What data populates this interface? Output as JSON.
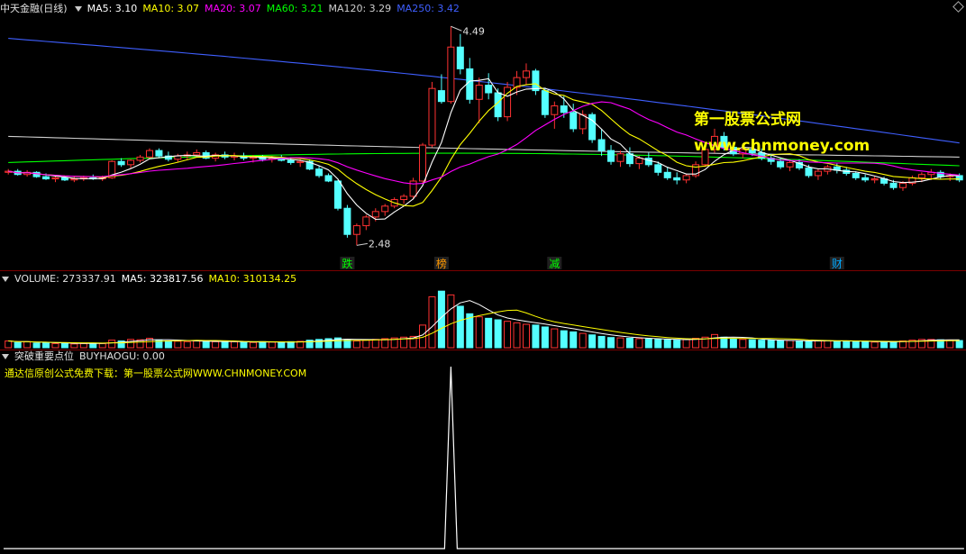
{
  "header": {
    "stock_name": "中天金融",
    "period": "(日线)",
    "ma": [
      {
        "label": "MA5: 3.10",
        "color": "#ffffff"
      },
      {
        "label": "MA10: 3.07",
        "color": "#ffff00"
      },
      {
        "label": "MA20: 3.07",
        "color": "#ff00ff"
      },
      {
        "label": "MA60: 3.21",
        "color": "#00ff00"
      },
      {
        "label": "MA120: 3.29",
        "color": "#cfcfcf"
      },
      {
        "label": "MA250: 3.42",
        "color": "#3f5fff"
      }
    ]
  },
  "volume_header": {
    "title": "VOLUME: 273337.91",
    "ma5": "MA5: 323817.56",
    "ma10": "MA10: 310134.25"
  },
  "indicator_header": {
    "name": "突破重要点位",
    "value": "BUYHAOGU: 0.00"
  },
  "download_text": "通达信原创公式免费下载：第一股票公式网WWW.CHNMONEY.COM",
  "watermark": {
    "line1": "第一股票公式网",
    "line2": "www.chnmoney.com"
  },
  "markers": [
    {
      "text": "跌",
      "bar": 36,
      "color": "#00ff00"
    },
    {
      "text": "榜",
      "bar": 46,
      "color": "#ff9900"
    },
    {
      "text": "减",
      "bar": 58,
      "color": "#00ff00"
    },
    {
      "text": "财",
      "bar": 88,
      "color": "#00aaff"
    }
  ],
  "chart_data": {
    "type": "candlestick",
    "ylim": [
      2.4,
      4.55
    ],
    "high_label": "4.49",
    "low_label": "2.48",
    "high_bar": 47,
    "low_bar": 37,
    "colors": {
      "up": "#ff3232",
      "down": "#54ffff"
    },
    "candles": [
      [
        3.15,
        3.18,
        3.13,
        3.16
      ],
      [
        3.16,
        3.18,
        3.12,
        3.13
      ],
      [
        3.13,
        3.17,
        3.11,
        3.15
      ],
      [
        3.15,
        3.16,
        3.1,
        3.11
      ],
      [
        3.11,
        3.14,
        3.08,
        3.09
      ],
      [
        3.09,
        3.12,
        3.06,
        3.1
      ],
      [
        3.1,
        3.12,
        3.07,
        3.08
      ],
      [
        3.08,
        3.11,
        3.06,
        3.09
      ],
      [
        3.09,
        3.12,
        3.07,
        3.1
      ],
      [
        3.1,
        3.13,
        3.08,
        3.09
      ],
      [
        3.09,
        3.12,
        3.07,
        3.1
      ],
      [
        3.1,
        3.26,
        3.09,
        3.25
      ],
      [
        3.25,
        3.28,
        3.2,
        3.22
      ],
      [
        3.22,
        3.27,
        3.19,
        3.26
      ],
      [
        3.26,
        3.31,
        3.24,
        3.29
      ],
      [
        3.29,
        3.37,
        3.27,
        3.35
      ],
      [
        3.35,
        3.37,
        3.28,
        3.3
      ],
      [
        3.3,
        3.34,
        3.25,
        3.27
      ],
      [
        3.27,
        3.32,
        3.24,
        3.3
      ],
      [
        3.3,
        3.34,
        3.27,
        3.31
      ],
      [
        3.31,
        3.36,
        3.29,
        3.33
      ],
      [
        3.33,
        3.35,
        3.27,
        3.28
      ],
      [
        3.28,
        3.33,
        3.25,
        3.31
      ],
      [
        3.31,
        3.34,
        3.27,
        3.29
      ],
      [
        3.29,
        3.33,
        3.26,
        3.3
      ],
      [
        3.3,
        3.33,
        3.26,
        3.28
      ],
      [
        3.28,
        3.31,
        3.24,
        3.29
      ],
      [
        3.29,
        3.31,
        3.25,
        3.27
      ],
      [
        3.27,
        3.3,
        3.24,
        3.28
      ],
      [
        3.28,
        3.31,
        3.25,
        3.26
      ],
      [
        3.26,
        3.29,
        3.22,
        3.24
      ],
      [
        3.24,
        3.27,
        3.2,
        3.25
      ],
      [
        3.25,
        3.27,
        3.17,
        3.18
      ],
      [
        3.18,
        3.21,
        3.1,
        3.12
      ],
      [
        3.12,
        3.14,
        3.06,
        3.07
      ],
      [
        3.07,
        3.08,
        2.8,
        2.82
      ],
      [
        2.82,
        2.85,
        2.55,
        2.58
      ],
      [
        2.58,
        2.68,
        2.48,
        2.66
      ],
      [
        2.66,
        2.76,
        2.62,
        2.74
      ],
      [
        2.74,
        2.82,
        2.7,
        2.79
      ],
      [
        2.79,
        2.86,
        2.75,
        2.84
      ],
      [
        2.84,
        2.92,
        2.82,
        2.9
      ],
      [
        2.9,
        2.95,
        2.86,
        2.93
      ],
      [
        2.93,
        3.1,
        2.9,
        3.07
      ],
      [
        3.07,
        3.42,
        3.05,
        3.4
      ],
      [
        3.4,
        3.98,
        3.38,
        3.92
      ],
      [
        3.9,
        4.05,
        3.78,
        3.8
      ],
      [
        3.8,
        4.49,
        3.78,
        4.3
      ],
      [
        4.3,
        4.42,
        4.05,
        4.1
      ],
      [
        4.1,
        4.2,
        3.78,
        3.82
      ],
      [
        3.82,
        4.02,
        3.6,
        3.95
      ],
      [
        3.95,
        4.06,
        3.82,
        3.88
      ],
      [
        3.88,
        3.92,
        3.62,
        3.66
      ],
      [
        3.66,
        3.98,
        3.62,
        3.93
      ],
      [
        3.93,
        4.08,
        3.86,
        4.02
      ],
      [
        4.02,
        4.15,
        3.95,
        4.08
      ],
      [
        4.08,
        4.1,
        3.86,
        3.9
      ],
      [
        3.9,
        3.92,
        3.65,
        3.68
      ],
      [
        3.68,
        3.8,
        3.55,
        3.76
      ],
      [
        3.76,
        3.85,
        3.65,
        3.7
      ],
      [
        3.7,
        3.78,
        3.52,
        3.55
      ],
      [
        3.55,
        3.72,
        3.5,
        3.68
      ],
      [
        3.68,
        3.7,
        3.42,
        3.45
      ],
      [
        3.45,
        3.55,
        3.3,
        3.35
      ],
      [
        3.35,
        3.4,
        3.22,
        3.25
      ],
      [
        3.25,
        3.35,
        3.2,
        3.32
      ],
      [
        3.32,
        3.38,
        3.2,
        3.23
      ],
      [
        3.23,
        3.3,
        3.18,
        3.28
      ],
      [
        3.28,
        3.33,
        3.2,
        3.22
      ],
      [
        3.22,
        3.25,
        3.12,
        3.15
      ],
      [
        3.15,
        3.2,
        3.08,
        3.1
      ],
      [
        3.1,
        3.15,
        3.04,
        3.08
      ],
      [
        3.08,
        3.14,
        3.05,
        3.12
      ],
      [
        3.12,
        3.25,
        3.1,
        3.22
      ],
      [
        3.22,
        3.4,
        3.2,
        3.36
      ],
      [
        3.36,
        3.55,
        3.33,
        3.48
      ],
      [
        3.48,
        3.52,
        3.35,
        3.38
      ],
      [
        3.38,
        3.42,
        3.3,
        3.32
      ],
      [
        3.32,
        3.38,
        3.28,
        3.36
      ],
      [
        3.36,
        3.4,
        3.3,
        3.33
      ],
      [
        3.33,
        3.37,
        3.26,
        3.28
      ],
      [
        3.28,
        3.32,
        3.22,
        3.25
      ],
      [
        3.25,
        3.28,
        3.18,
        3.2
      ],
      [
        3.2,
        3.26,
        3.16,
        3.24
      ],
      [
        3.24,
        3.27,
        3.17,
        3.19
      ],
      [
        3.19,
        3.22,
        3.1,
        3.12
      ],
      [
        3.12,
        3.18,
        3.08,
        3.16
      ],
      [
        3.16,
        3.22,
        3.13,
        3.2
      ],
      [
        3.2,
        3.23,
        3.14,
        3.17
      ],
      [
        3.17,
        3.2,
        3.12,
        3.14
      ],
      [
        3.14,
        3.16,
        3.08,
        3.1
      ],
      [
        3.1,
        3.13,
        3.06,
        3.08
      ],
      [
        3.08,
        3.11,
        3.05,
        3.09
      ],
      [
        3.09,
        3.11,
        3.03,
        3.05
      ],
      [
        3.05,
        3.08,
        2.99,
        3.01
      ],
      [
        3.01,
        3.07,
        2.98,
        3.05
      ],
      [
        3.05,
        3.12,
        3.03,
        3.1
      ],
      [
        3.1,
        3.15,
        3.06,
        3.13
      ],
      [
        3.13,
        3.18,
        3.08,
        3.15
      ],
      [
        3.15,
        3.17,
        3.09,
        3.11
      ],
      [
        3.11,
        3.14,
        3.07,
        3.12
      ],
      [
        3.12,
        3.14,
        3.06,
        3.08
      ]
    ],
    "volume": [
      18,
      14,
      16,
      12,
      13,
      11,
      12,
      10,
      11,
      12,
      11,
      20,
      18,
      22,
      21,
      25,
      20,
      18,
      17,
      16,
      18,
      17,
      16,
      15,
      16,
      15,
      14,
      16,
      15,
      14,
      16,
      17,
      20,
      22,
      24,
      26,
      21,
      18,
      20,
      22,
      24,
      26,
      28,
      30,
      60,
      135,
      150,
      140,
      110,
      90,
      82,
      78,
      74,
      70,
      66,
      62,
      60,
      55,
      50,
      45,
      42,
      38,
      34,
      30,
      27,
      26,
      25,
      24,
      23,
      22,
      21,
      20,
      22,
      25,
      28,
      35,
      28,
      24,
      22,
      21,
      20,
      19,
      18,
      19,
      18,
      17,
      18,
      19,
      18,
      17,
      16,
      16,
      15,
      15,
      16,
      18,
      20,
      22,
      22,
      21,
      20,
      19
    ],
    "volume_ylim": [
      0,
      160
    ],
    "indicator": {
      "spike_bar": 47,
      "value_peak": 1,
      "value_now": 0.0
    }
  }
}
